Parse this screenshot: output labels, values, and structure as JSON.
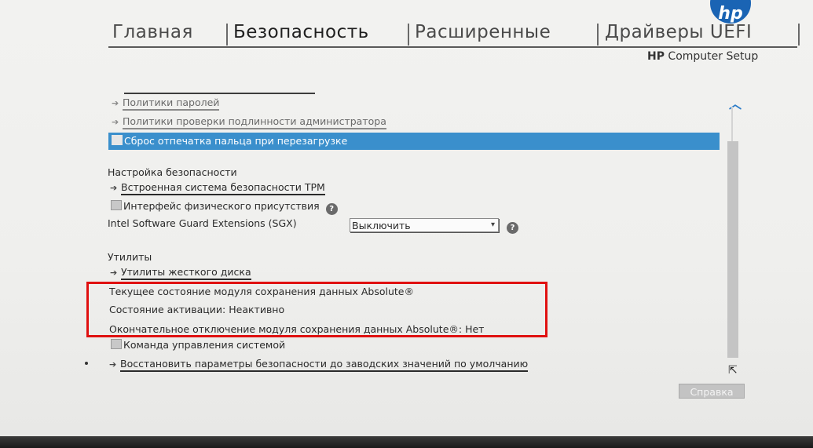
{
  "tabs": [
    {
      "label": "Главная"
    },
    {
      "label": "Безопасность"
    },
    {
      "label": "Расширенные"
    },
    {
      "label": "Драйверы UEFI"
    }
  ],
  "brand": {
    "logo_text": "hp",
    "bold": "HP",
    "rest": " Computer Setup"
  },
  "menu": {
    "password_policies": "Политики паролей",
    "admin_auth_policies": "Политики проверки подлинности администратора",
    "fingerprint_reset": "Сброс отпечатка пальца при перезагрузке"
  },
  "security_settings": {
    "heading": "Настройка безопасности",
    "tpm": "Встроенная система безопасности TPM",
    "physical_presence": "Интерфейс физического присутствия",
    "sgx_label": "Intel Software Guard Extensions (SGX)",
    "sgx_value": "Выключить"
  },
  "utilities": {
    "heading": "Утилиты",
    "hdd_utilities": "Утилиты жесткого диска",
    "absolute_state": "Текущее состояние модуля сохранения данных Absolute®",
    "activation_state": "Состояние активации: Неактивно",
    "absolute_disable": "Окончательное отключение модуля сохранения данных Absolute®: Нет",
    "system_mgmt_cmd": "Команда управления системой",
    "restore_defaults": "Восстановить параметры безопасности до заводских значений по умолчанию"
  },
  "help_glyph": "?",
  "help_button": "Справка",
  "icons": {
    "arrow": "arrow-right-icon",
    "help": "question-icon",
    "scroll_up": "chevron-up-icon",
    "cursor": "mouse-pointer-icon"
  },
  "colors": {
    "selection": "#3a8fcc",
    "hp_blue": "#1a64b4",
    "highlight_box": "#e01010"
  }
}
